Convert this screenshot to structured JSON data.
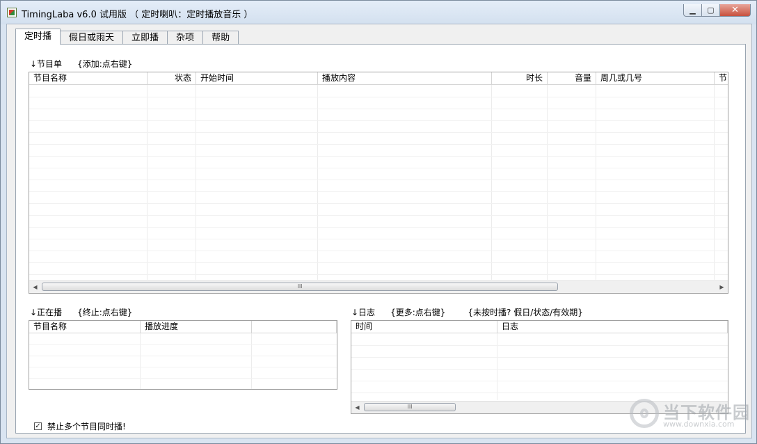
{
  "window": {
    "title": "TimingLaba v6.0 试用版 （ 定时喇叭：定时播放音乐 ）",
    "min_glyph": "▁",
    "max_glyph": "▢",
    "close_glyph": "✕",
    "icon": "app-icon"
  },
  "tabs": [
    {
      "label": "定时播",
      "active": true
    },
    {
      "label": "假日或雨天",
      "active": false
    },
    {
      "label": "立即播",
      "active": false
    },
    {
      "label": "杂项",
      "active": false
    },
    {
      "label": "帮助",
      "active": false
    }
  ],
  "programs": {
    "label": "↓节目单",
    "hint": "{添加:点右键}",
    "columns": [
      "节目名称",
      "状态",
      "开始时间",
      "播放内容",
      "时长",
      "音量",
      "周几或几号",
      "节"
    ],
    "rows": []
  },
  "playing": {
    "label": "↓正在播",
    "hint": "{终止:点右键}",
    "columns": [
      "节目名称",
      "播放进度",
      ""
    ],
    "rows": []
  },
  "log": {
    "label": "↓日志",
    "hint": "{更多:点右键}",
    "hint2": "{未按时播? 假日/状态/有效期}",
    "columns": [
      "时间",
      "日志"
    ],
    "rows": []
  },
  "options": {
    "no_overlap_label": "禁止多个节目同时播!",
    "no_overlap_checked": true
  },
  "scrollbar": {
    "left_arrow": "◀",
    "right_arrow": "▶",
    "grip": "III"
  },
  "watermark": {
    "text": "当下软件园",
    "url": "www.downxia.com"
  }
}
